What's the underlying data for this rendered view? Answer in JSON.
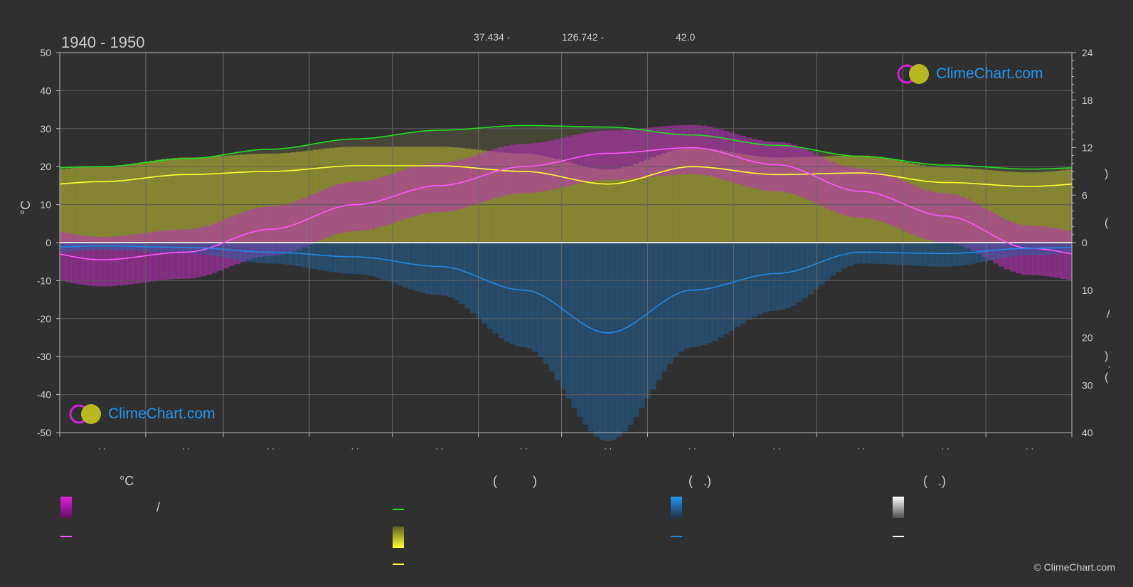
{
  "header": {
    "period": "1940 - 1950",
    "lat": "37.434 -",
    "lon": "126.742 -",
    "elev": "42.0"
  },
  "brand": {
    "name": "ClimeChart.com",
    "copyright": "© ClimeChart.com"
  },
  "colors": {
    "temp": "#ff55ff",
    "daylight": "#22dd22",
    "sunshine": "#ffff33",
    "precip": "#1f88e5",
    "snow": "#ffffff",
    "tempband": "#e020e0"
  },
  "legend": {
    "temp_unit": "°C",
    "slash": "/",
    "paren_col2": "(          )",
    "paren_col3": "(   .)",
    "paren_col4": "(   .)"
  },
  "chart_data": {
    "type": "line",
    "title": "1940 - 1950",
    "ylabel_left": "°C",
    "ylim_left": [
      -50,
      50
    ],
    "yticks_left": [
      50,
      40,
      30,
      20,
      10,
      0,
      -10,
      -20,
      -30,
      -40,
      -50
    ],
    "ylim_right_hours": [
      0,
      24
    ],
    "yticks_right_hours": [
      24,
      18,
      12,
      6,
      0
    ],
    "ylim_right_precip": [
      0,
      40
    ],
    "yticks_right_precip": [
      10,
      20,
      30,
      40
    ],
    "categories": [
      "· ·",
      "· ·",
      "· ·",
      "· ·",
      "· ·",
      "· ·",
      "· ·",
      "· ·",
      "· ·",
      "· ·",
      "· ·",
      "· ·"
    ],
    "series": [
      {
        "key": "temp_mean",
        "values": [
          -4.5,
          -2.5,
          3.5,
          10,
          15,
          20,
          23.5,
          25,
          20.5,
          13.5,
          7,
          -1.5
        ]
      },
      {
        "key": "daylight_hours",
        "values": [
          9.6,
          10.6,
          11.8,
          13.1,
          14.2,
          14.8,
          14.6,
          13.6,
          12.3,
          10.9,
          9.8,
          9.3
        ]
      },
      {
        "key": "sunshine_hours",
        "values": [
          7.7,
          8.6,
          9.0,
          9.7,
          9.7,
          9.0,
          7.4,
          9.6,
          8.6,
          8.8,
          7.6,
          7.1
        ]
      },
      {
        "key": "precip_mm",
        "values": [
          0.7,
          1.0,
          2.0,
          3.0,
          5.0,
          10.0,
          19.0,
          10.0,
          6.5,
          2.0,
          2.3,
          1.2
        ]
      }
    ],
    "grid": true
  }
}
